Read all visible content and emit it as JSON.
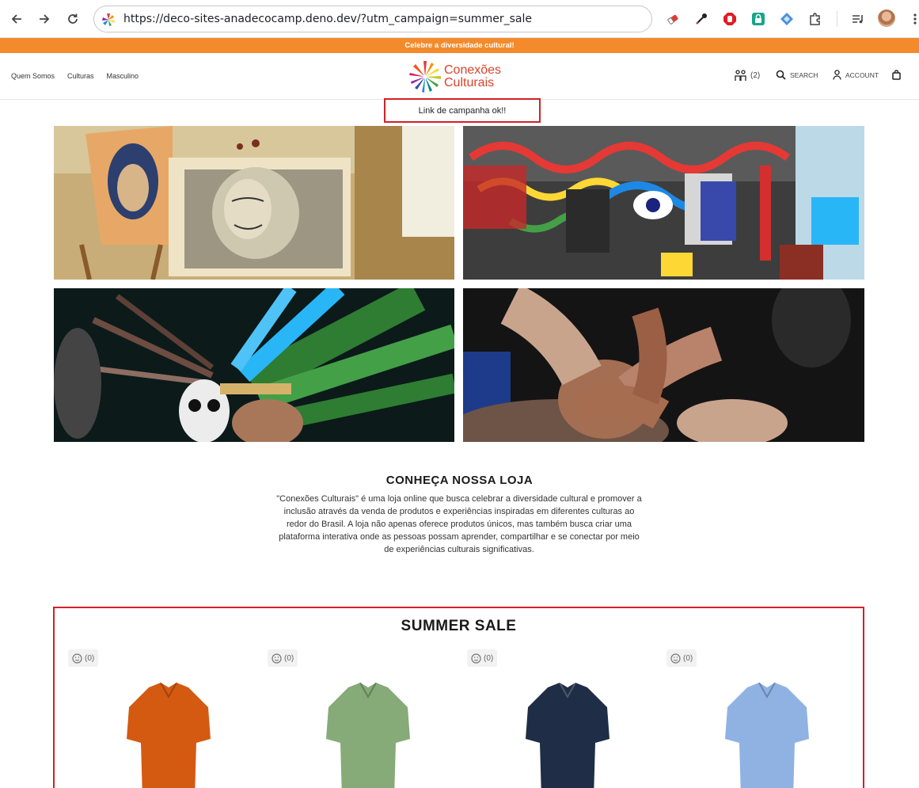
{
  "browser": {
    "url": "https://deco-sites-anadecocamp.deno.dev/?utm_campaign=summer_sale"
  },
  "promo_bar": {
    "text": "Celebre a diversidade cultural!"
  },
  "header": {
    "menu": [
      "Quem Somos",
      "Culturas",
      "Masculino"
    ],
    "logo_line1": "Conexões",
    "logo_line2": "Culturais",
    "compare_count": "(2)",
    "search_label": "SEARCH",
    "account_label": "ACCOUNT"
  },
  "campaign_notice": "Link de campanha ok!!",
  "about": {
    "title": "CONHEÇA NOSSA LOJA",
    "text": "\"Conexões Culturais\" é uma loja online que busca celebrar a diversidade cultural e promover a inclusão através da venda de produtos e experiências inspiradas em diferentes culturas ao redor do Brasil. A loja não apenas oferece produtos únicos, mas também busca criar uma plataforma interativa onde as pessoas possam aprender, compartilhar e se conectar por meio de experiências culturais significativas."
  },
  "sale": {
    "title": "SUMMER SALE",
    "products": [
      {
        "reviews": "(0)",
        "color": "#d45a12"
      },
      {
        "reviews": "(0)",
        "color": "#86aa78"
      },
      {
        "reviews": "(0)",
        "color": "#1f2d46"
      },
      {
        "reviews": "(0)",
        "color": "#8fb2e2"
      }
    ]
  },
  "colors": {
    "accent_orange": "#f38b2c",
    "highlight_red": "#d32027",
    "logo_red": "#d8432a"
  }
}
